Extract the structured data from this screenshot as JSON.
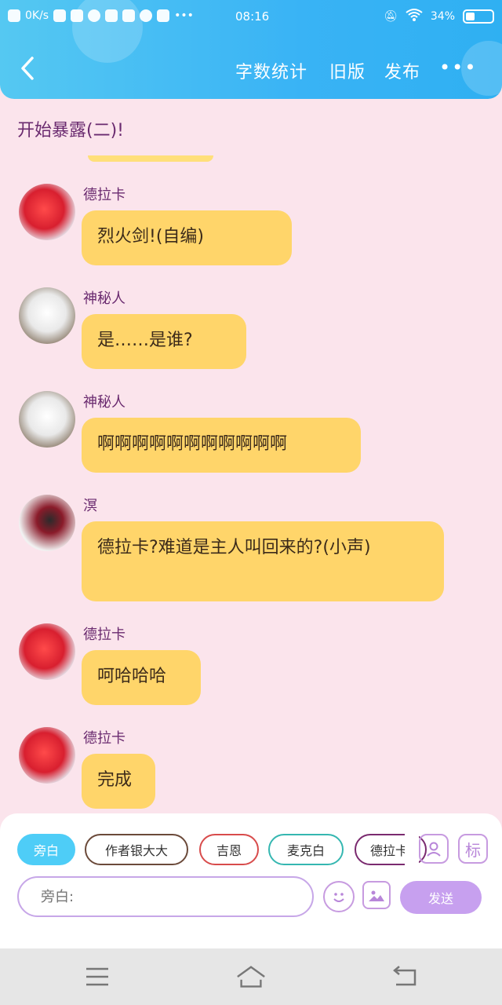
{
  "status_bar": {
    "network_speed": "0K/s",
    "time": "08:16",
    "battery": "34%",
    "battery_level": 0.34
  },
  "header": {
    "word_count_label": "字数统计",
    "old_version_label": "旧版",
    "publish_label": "发布",
    "more_label": "•••",
    "back_label": "‹"
  },
  "chapter_title": "开始暴露(二)!",
  "messages": [
    {
      "sender": "德拉卡",
      "text": "烈火剑!(自编)",
      "avatar": "dragon-avatar"
    },
    {
      "sender": "神秘人",
      "text": "是……是谁?",
      "avatar": "dog-avatar"
    },
    {
      "sender": "神秘人",
      "text": "啊啊啊啊啊啊啊啊啊啊啊",
      "avatar": "dog-avatar"
    },
    {
      "sender": "溟",
      "text": "德拉卡?难道是主人叫回来的?(小声)",
      "avatar": "anime-avatar"
    },
    {
      "sender": "德拉卡",
      "text": "呵哈哈哈",
      "avatar": "dragon-avatar"
    },
    {
      "sender": "德拉卡",
      "text": "完成",
      "avatar": "dragon-avatar"
    }
  ],
  "composer": {
    "chips": [
      {
        "label": "旁白",
        "active": true,
        "color": "#4ecdf7"
      },
      {
        "label": "作者银大大",
        "active": false,
        "color": "#6b4a3a"
      },
      {
        "label": "吉恩",
        "active": false,
        "color": "#d84b4b"
      },
      {
        "label": "麦克白",
        "active": false,
        "color": "#35b7b1"
      },
      {
        "label": "德拉卡",
        "active": false,
        "color": "#7a2a6f"
      }
    ],
    "tag_label": "标",
    "input_placeholder": "旁白:",
    "send_label": "发送"
  },
  "icons": {
    "avatar_icon": "person-icon",
    "emoji_icon": "smile-icon",
    "image_icon": "image-icon",
    "menu_icon": "menu-icon",
    "home_icon": "home-icon",
    "back_nav_icon": "return-icon"
  }
}
